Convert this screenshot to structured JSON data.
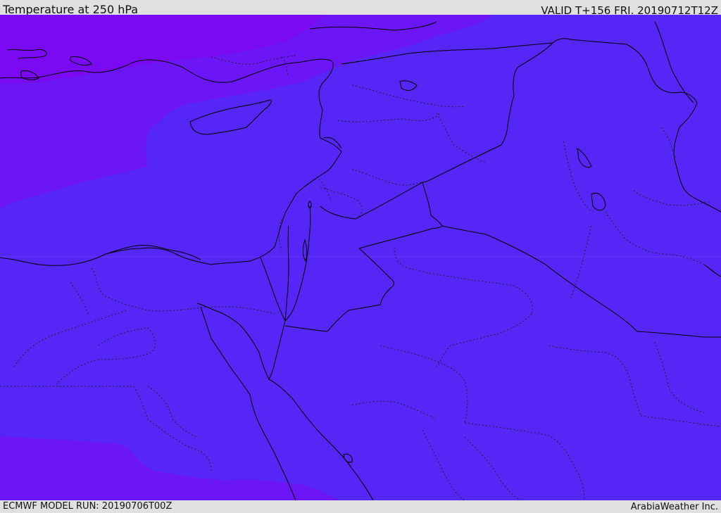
{
  "header": {
    "title": "Temperature at 250 hPa",
    "valid_label": "VALID T+156 FRI. 20190712T12Z"
  },
  "footer": {
    "model_run": "ECMWF MODEL RUN: 20190706T00Z",
    "credit": "ArabiaWeather Inc."
  },
  "map": {
    "parameter": "Temperature",
    "level_hpa": 250,
    "colors": {
      "field_main": "#5626f6",
      "field_warm_band": "#6c16f7",
      "field_hot_band": "#7a0af4",
      "coastline": "#000000",
      "border": "#000000",
      "province": "#1a1a3a"
    }
  }
}
